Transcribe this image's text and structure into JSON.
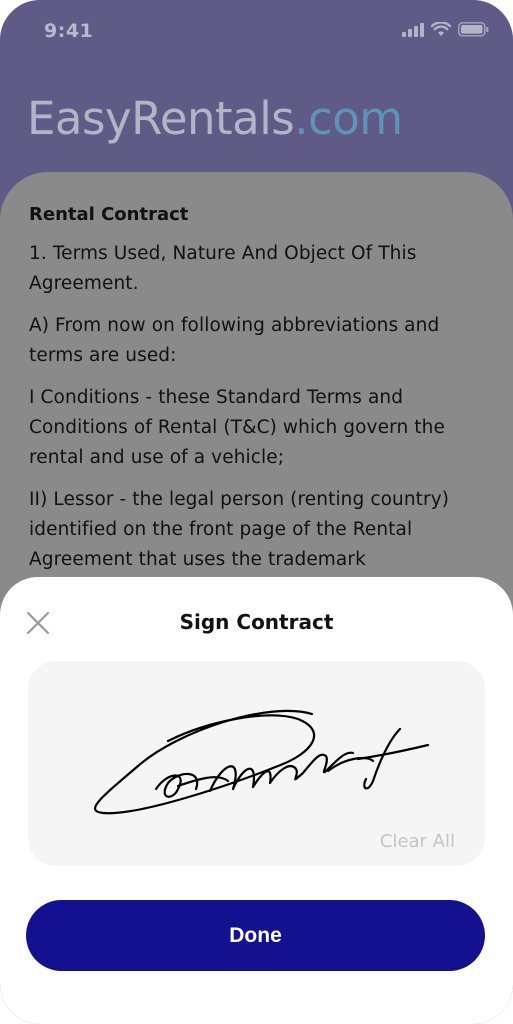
{
  "status_bar": {
    "time": "9:41",
    "icons": [
      "signal-icon",
      "wifi-icon",
      "battery-icon"
    ]
  },
  "brand": {
    "name": "EasyRentals",
    "tld": ".com"
  },
  "contract": {
    "title": "Rental Contract",
    "paragraphs": [
      "1. Terms Used, Nature And Object Of This Agreement.",
      "A) From now on following abbreviations and terms are used:",
      "I Conditions - these Standard Terms and Conditions of Rental (T&C) which govern the rental and use of a vehicle;",
      "II) Lessor - the legal person (renting country) identified on the front page of the Rental Agreement that uses the trademark"
    ]
  },
  "sign_sheet": {
    "title": "Sign Contract",
    "close_icon": "close-icon",
    "clear_label": "Clear All",
    "done_label": "Done"
  },
  "colors": {
    "header_bg": "#5f5b86",
    "brand_tld": "#5e94b8",
    "done_button": "#141191",
    "overlay_content": "#8a8a8a"
  }
}
